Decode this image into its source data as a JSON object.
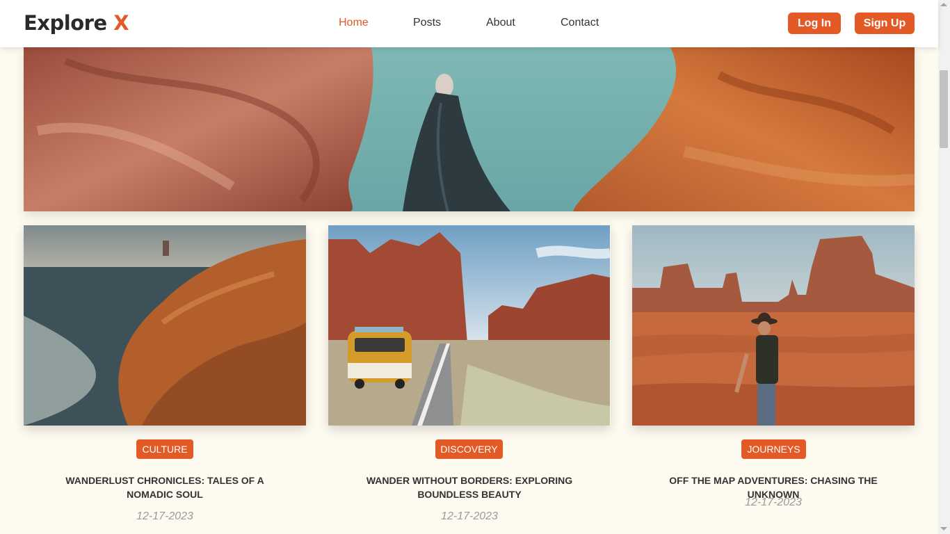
{
  "brand": {
    "name": "Explore",
    "accent_letter": "X",
    "accent_color": "#e35a26"
  },
  "nav": {
    "items": [
      {
        "label": "Home",
        "active": true
      },
      {
        "label": "Posts",
        "active": false
      },
      {
        "label": "About",
        "active": false
      },
      {
        "label": "Contact",
        "active": false
      }
    ]
  },
  "auth": {
    "login_label": "Log In",
    "signup_label": "Sign Up"
  },
  "hero": {
    "image_icon": "desert-canyon-figure-photo"
  },
  "posts": [
    {
      "tag": "CULTURE",
      "title": "WANDERLUST CHRONICLES: TALES OF A NOMADIC SOUL",
      "date": "12-17-2023",
      "image_icon": "coastal-cliff-photo"
    },
    {
      "tag": "DISCOVERY",
      "title": "WANDER WITHOUT BORDERS: EXPLORING BOUNDLESS BEAUTY",
      "date": "12-17-2023",
      "image_icon": "desert-road-van-photo"
    },
    {
      "tag": "JOURNEYS",
      "title": "OFF THE MAP ADVENTURES: CHASING THE UNKNOWN",
      "date": "12-17-2023",
      "image_icon": "monument-valley-hiker-photo"
    }
  ]
}
